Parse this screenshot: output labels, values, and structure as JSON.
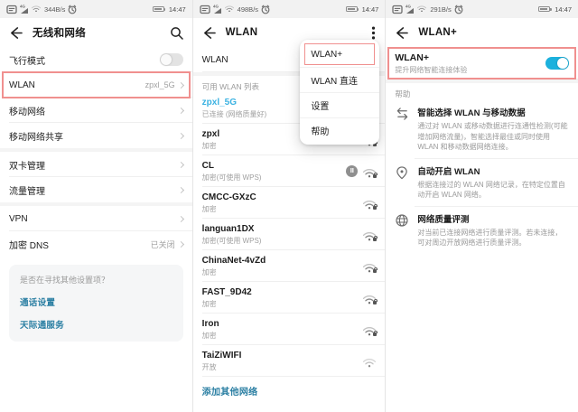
{
  "colors": {
    "annotation": "#f0908f",
    "toggle_on": "#1cb1dd",
    "link": "#2b7fa3",
    "connected_ssid": "#3ab2e2"
  },
  "panel1": {
    "status_speed": "344B/s",
    "time": "14:47",
    "title": "无线和网络",
    "airplane_label": "飞行模式",
    "wlan": {
      "label": "WLAN",
      "value": "zpxl_5G"
    },
    "mobile_network": "移动网络",
    "tethering": "移动网络共享",
    "dual_sim": "双卡管理",
    "data_usage": "流量管理",
    "vpn": "VPN",
    "dns": {
      "label": "加密 DNS",
      "value": "已关闭"
    },
    "suggest": {
      "question": "是否在寻找其他设置项？",
      "link1": "通话设置",
      "link2": "天际通服务"
    }
  },
  "panel2": {
    "status_speed": "498B/s",
    "time": "14:47",
    "title": "WLAN",
    "wlan_row_label": "WLAN",
    "section_label": "可用 WLAN 列表",
    "networks": [
      {
        "ssid": "zpxl_5G",
        "sub": "已连接 (网络质量好)"
      },
      {
        "ssid": "zpxl",
        "sub": "加密"
      },
      {
        "ssid": "CL",
        "sub": "加密(可使用 WPS)"
      },
      {
        "ssid": "CMCC-GXzC",
        "sub": "加密"
      },
      {
        "ssid": "languan1DX",
        "sub": "加密(可使用 WPS)"
      },
      {
        "ssid": "ChinaNet-4vZd",
        "sub": "加密"
      },
      {
        "ssid": "FAST_9D42",
        "sub": "加密"
      },
      {
        "ssid": "Iron",
        "sub": "加密"
      },
      {
        "ssid": "TaiZiWIFI",
        "sub": "开放"
      }
    ],
    "add_network": "添加其他网络",
    "menu": {
      "item1": "WLAN+",
      "item2": "WLAN 直连",
      "item3": "设置",
      "item4": "帮助"
    }
  },
  "panel3": {
    "status_speed": "291B/s",
    "time": "14:47",
    "title": "WLAN+",
    "toggle_row": {
      "title": "WLAN+",
      "subtitle": "提升网络智能连接体验"
    },
    "section_label": "帮助",
    "items": [
      {
        "title": "智能选择 WLAN 与移动数据",
        "desc": "通过对 WLAN 或移动数据进行连通性检测(可能增加网络流量)，智能选择最佳或同时使用 WLAN 和移动数据网络连接。"
      },
      {
        "title": "自动开启 WLAN",
        "desc": "根据连接过的 WLAN 网络记录，在特定位置自动开启 WLAN 网络。"
      },
      {
        "title": "网络质量评测",
        "desc": "对当前已连接网络进行质量评测。若未连接，可对周边开放网络进行质量评测。"
      }
    ]
  }
}
